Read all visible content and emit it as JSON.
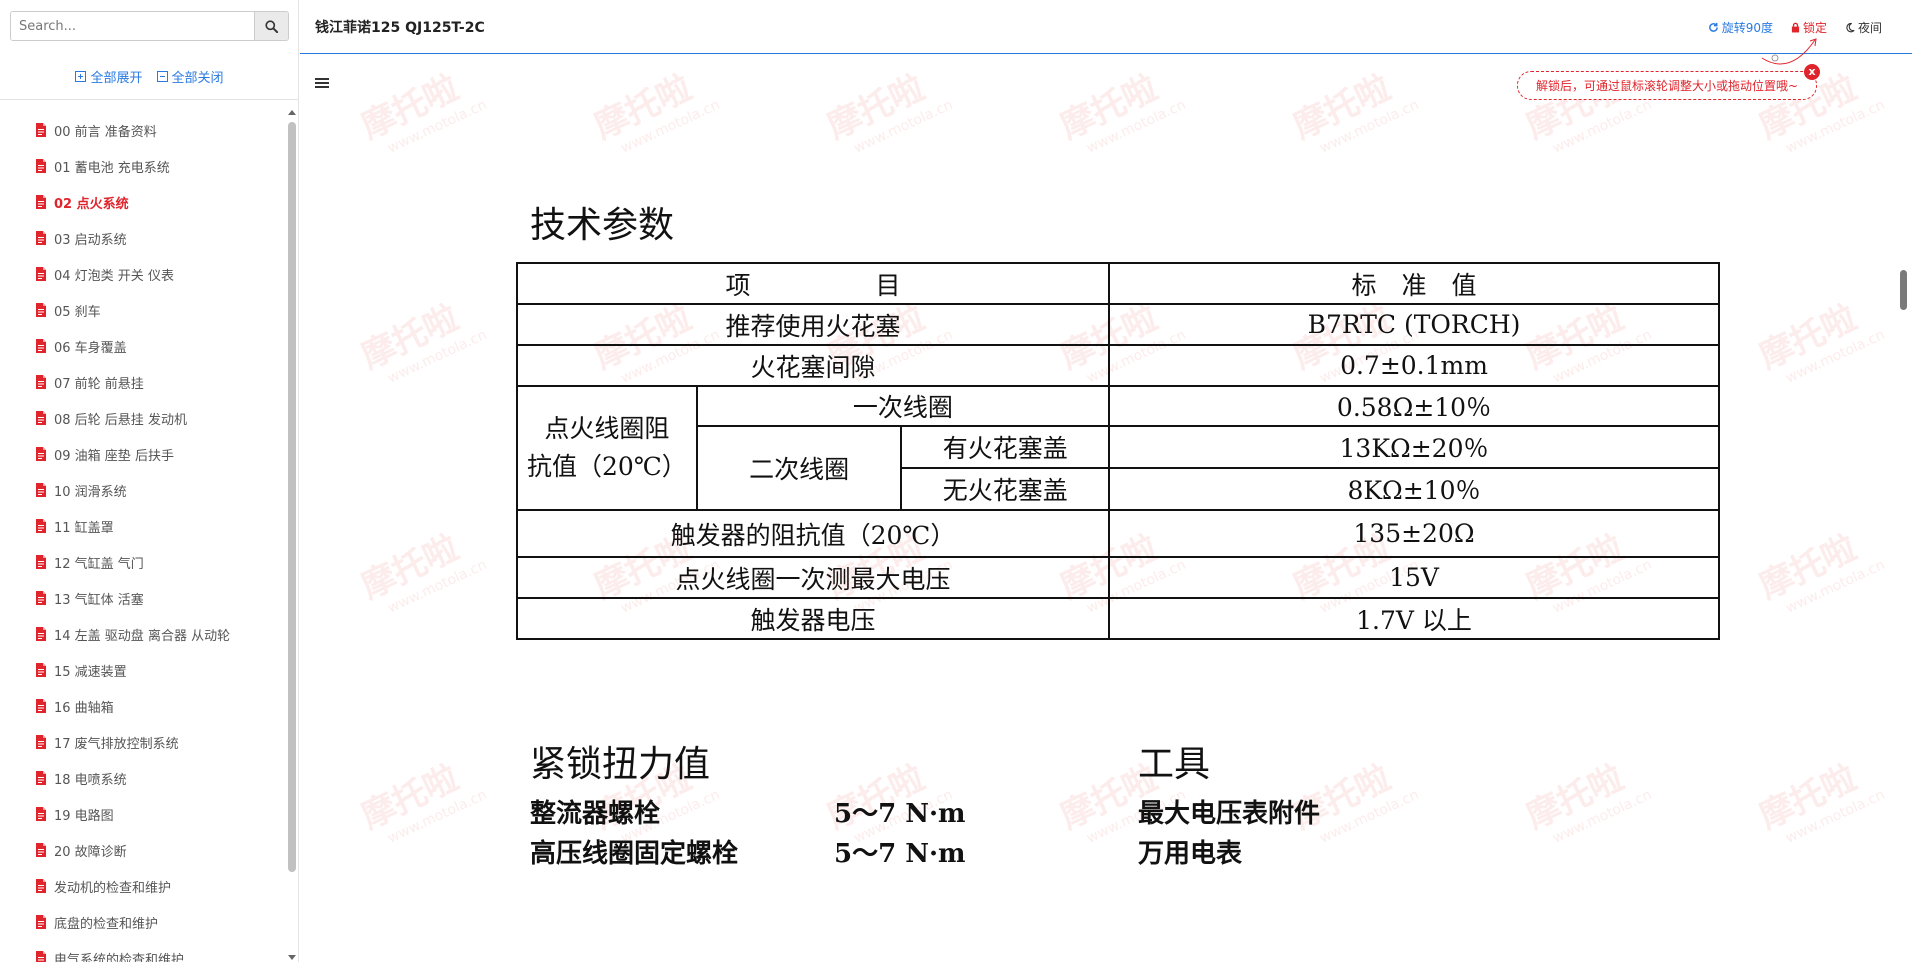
{
  "sidebar": {
    "search_placeholder": "Search...",
    "expand_all": "全部展开",
    "collapse_all": "全部关闭",
    "items": [
      {
        "label": "00 前言 准备资料",
        "active": false
      },
      {
        "label": "01 蓄电池 充电系统",
        "active": false
      },
      {
        "label": "02 点火系统",
        "active": true
      },
      {
        "label": "03 启动系统",
        "active": false
      },
      {
        "label": "04 灯泡类 开关 仪表",
        "active": false
      },
      {
        "label": "05 刹车",
        "active": false
      },
      {
        "label": "06 车身覆盖",
        "active": false
      },
      {
        "label": "07 前轮 前悬挂",
        "active": false
      },
      {
        "label": "08 后轮 后悬挂 发动机",
        "active": false
      },
      {
        "label": "09 油箱 座垫 后扶手",
        "active": false
      },
      {
        "label": "10 润滑系统",
        "active": false
      },
      {
        "label": "11 缸盖罩",
        "active": false
      },
      {
        "label": "12 气缸盖 气门",
        "active": false
      },
      {
        "label": "13 气缸体 活塞",
        "active": false
      },
      {
        "label": "14 左盖 驱动盘 离合器 从动轮",
        "active": false
      },
      {
        "label": "15 减速装置",
        "active": false
      },
      {
        "label": "16 曲轴箱",
        "active": false
      },
      {
        "label": "17 废气排放控制系统",
        "active": false
      },
      {
        "label": "18 电喷系统",
        "active": false
      },
      {
        "label": "19 电路图",
        "active": false
      },
      {
        "label": "20 故障诊断",
        "active": false
      },
      {
        "label": "发动机的检查和维护",
        "active": false
      },
      {
        "label": "底盘的检查和维护",
        "active": false
      },
      {
        "label": "电气系统的检查和维护",
        "active": false
      }
    ]
  },
  "header": {
    "title": "钱江菲诺125 QJ125T-2C",
    "rotate_label": "旋转90度",
    "lock_label": "锁定",
    "night_label": "夜间"
  },
  "tip": {
    "text": "解锁后，可通过鼠标滚轮调整大小或拖动位置哦~",
    "close": "x"
  },
  "watermark": {
    "brand": "摩托啦",
    "url": "www.motola.cn"
  },
  "document": {
    "spec_title": "技术参数",
    "table": {
      "header_item": "项　　　　　目",
      "header_value": "标　准　值",
      "r1_item": "推荐使用火花塞",
      "r1_value": "B7RTC (TORCH)",
      "r2_item": "火花塞间隙",
      "r2_value": "0.7±0.1mm",
      "coil_label_1": "点火线圈阻",
      "coil_label_2": "抗值（20℃）",
      "primary_label": "一次线圈",
      "primary_value": "0.58Ω±10％",
      "secondary_label": "二次线圈",
      "with_cap_label": "有火花塞盖",
      "with_cap_value": "13KΩ±20％",
      "without_cap_label": "无火花塞盖",
      "without_cap_value": "8KΩ±10％",
      "r5_item": "触发器的阻抗值（20℃）",
      "r5_value": "135±20Ω",
      "r6_item": "点火线圈一次测最大电压",
      "r6_value": "15V",
      "r7_item": "触发器电压",
      "r7_value": "1.7V 以上"
    },
    "torque_title": "紧锁扭力值",
    "torque": [
      {
        "name": "整流器螺栓",
        "value": "5～7 N·m"
      },
      {
        "name": "高压线圈固定螺栓",
        "value": "5～7 N·m"
      }
    ],
    "tools_title": "工具",
    "tools": [
      "最大电压表附件",
      "万用电表"
    ]
  },
  "colors": {
    "accent": "#2a7ae2",
    "active": "#e0242b",
    "watermark": "#e66e64"
  }
}
